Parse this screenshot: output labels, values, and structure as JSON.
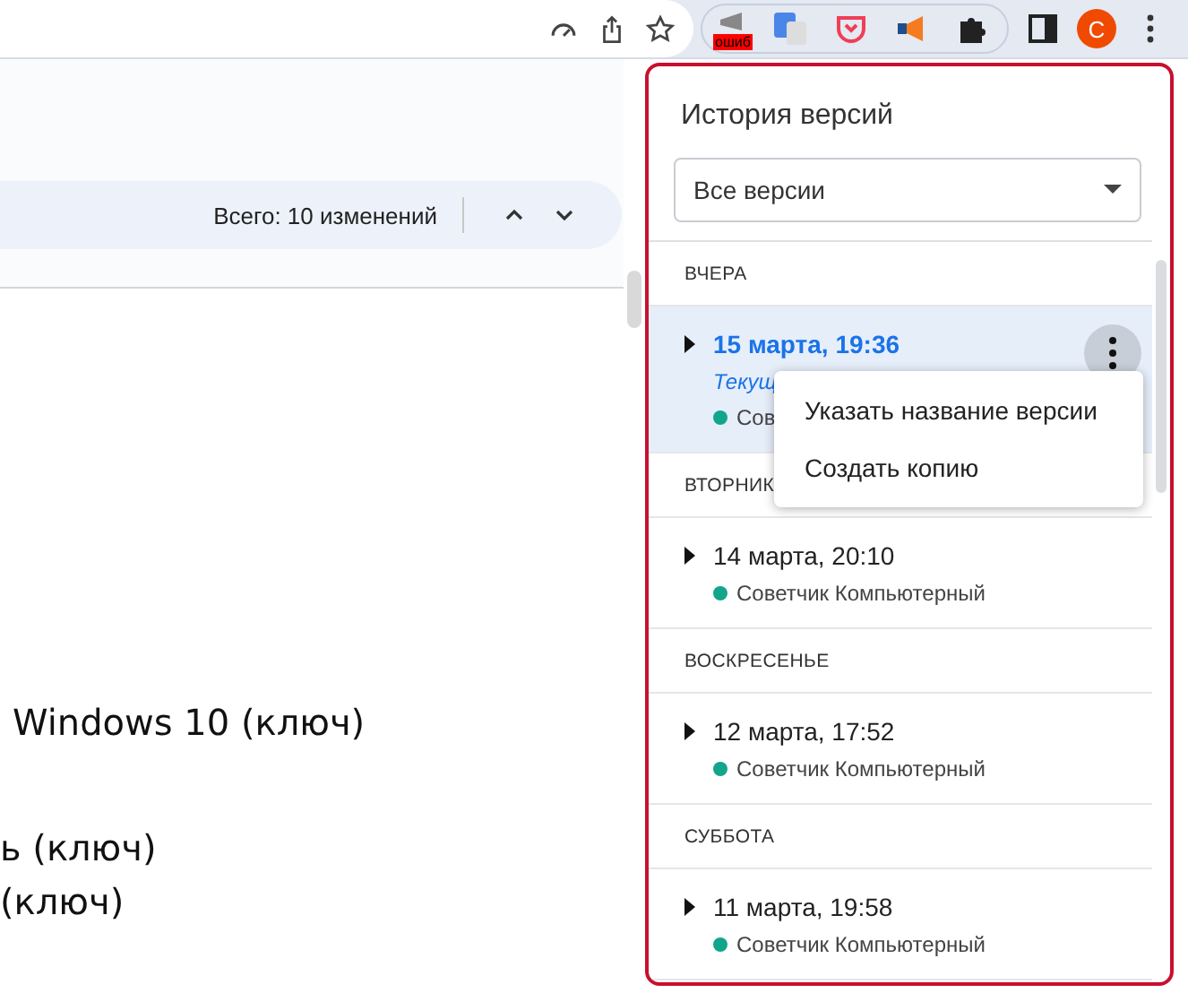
{
  "toolbar": {
    "extension_badge": "ошиб",
    "avatar": "С"
  },
  "changes_bar": {
    "total": "Всего: 10 изменений"
  },
  "document": {
    "lines": [
      "Windows 10 (ключ)",
      "ь (ключ)",
      "(ключ)"
    ]
  },
  "panel": {
    "title": "История версий",
    "filter": "Все версии",
    "sections": [
      {
        "heading": "ВЧЕРА",
        "versions": [
          {
            "date": "15 марта, 19:36",
            "selected": true,
            "label": "Текущ",
            "author": "Сов",
            "color": "#12a58a"
          }
        ]
      },
      {
        "heading": "ВТОРНИК",
        "versions": [
          {
            "date": "14 марта, 20:10",
            "selected": false,
            "author": "Советчик Компьютерный",
            "color": "#12a58a"
          }
        ]
      },
      {
        "heading": "ВОСКРЕСЕНЬЕ",
        "versions": [
          {
            "date": "12 марта, 17:52",
            "selected": false,
            "author": "Советчик Компьютерный",
            "color": "#12a58a"
          }
        ]
      },
      {
        "heading": "СУББОТА",
        "versions": [
          {
            "date": "11 марта, 19:58",
            "selected": false,
            "author": "Советчик Компьютерный",
            "color": "#12a58a"
          }
        ]
      }
    ],
    "menu": [
      "Указать название версии",
      "Создать копию"
    ]
  }
}
